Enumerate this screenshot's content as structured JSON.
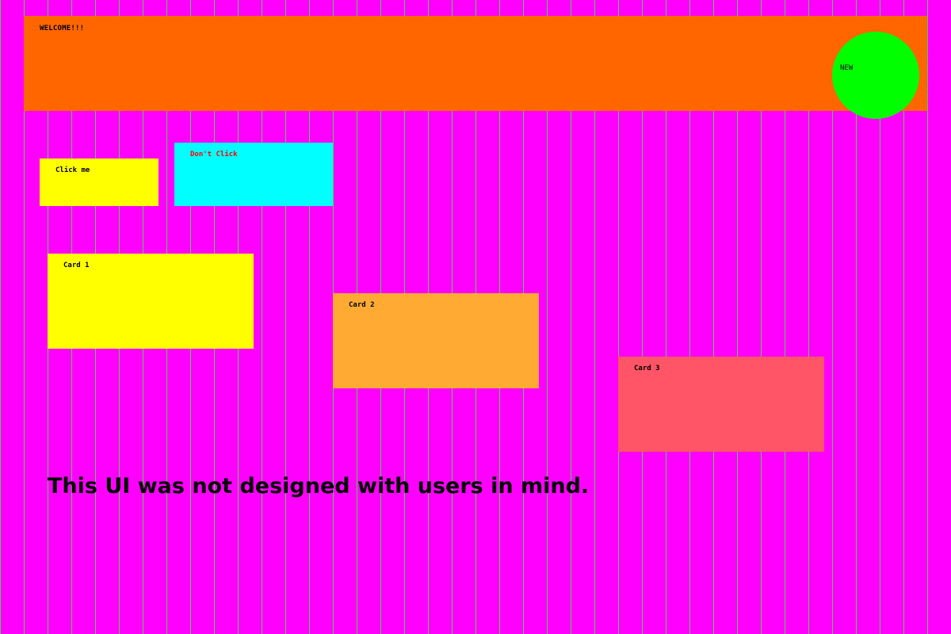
{
  "colors": {
    "background": "#ff00ff",
    "grid_lines": "#55cc55",
    "banner": "#ff6600",
    "new_badge": "#00ff00",
    "click_me_button": "#ffff00",
    "dont_click_button": "#00ffff",
    "dont_click_text": "#ff0000",
    "card_1": "#ffff00",
    "card_2": "#ffaa33",
    "card_3": "#ff5566"
  },
  "banner": {
    "title": "WELCOME!!!",
    "badge_label": "NEW"
  },
  "buttons": {
    "click_me": "Click me",
    "dont_click": "Don't Click"
  },
  "cards": [
    {
      "title": "Card 1"
    },
    {
      "title": "Card 2"
    },
    {
      "title": "Card 3"
    }
  ],
  "tagline": "This UI was not designed with users in mind."
}
